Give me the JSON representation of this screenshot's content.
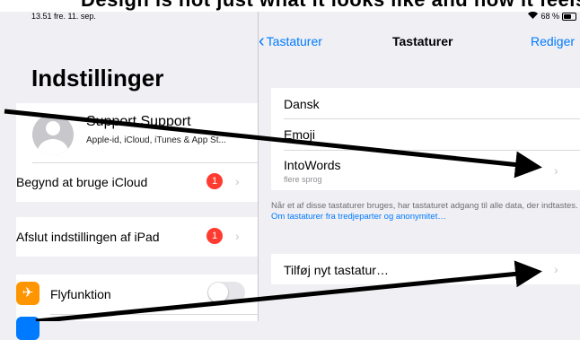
{
  "banner": {
    "text": "Design is not just what it looks like and how it feels. Design is how it works."
  },
  "status_bar": {
    "time": "13.51  fre. 11. sep.",
    "battery": "68 %",
    "battery_level": 0.68
  },
  "left": {
    "title": "Indstillinger",
    "profile": {
      "name": "Support Support",
      "subtitle": "Apple-id, iCloud, iTunes & App St..."
    },
    "icloud_row": {
      "label": "Begynd at bruge iCloud",
      "badge": "1"
    },
    "finish_row": {
      "label": "Afslut indstillingen af iPad",
      "badge": "1"
    },
    "airplane_row": {
      "label": "Flyfunktion",
      "toggle_on": false
    }
  },
  "nav": {
    "back": "Tastaturer",
    "title": "Tastaturer",
    "edit": "Rediger"
  },
  "keyboards": [
    {
      "label": "Dansk"
    },
    {
      "label": "Emoji"
    },
    {
      "label": "IntoWords",
      "sub": "flere sprog"
    }
  ],
  "footnote": {
    "text": "Når et af disse tastaturer bruges, har tastaturet adgang til alle data, der indtastes. ",
    "link": "Om tastaturer fra tredjeparter og anonymitet…"
  },
  "add_keyboard": {
    "label": "Tilføj nyt tastatur…"
  },
  "colors": {
    "accent": "#007aff",
    "badge": "#ff3b30",
    "airplane": "#ff9500",
    "arrow": "#000000"
  },
  "icons": {
    "airplane": "airplane-icon",
    "wifi": "wifi-icon",
    "chevron": "chevron-right-icon"
  }
}
